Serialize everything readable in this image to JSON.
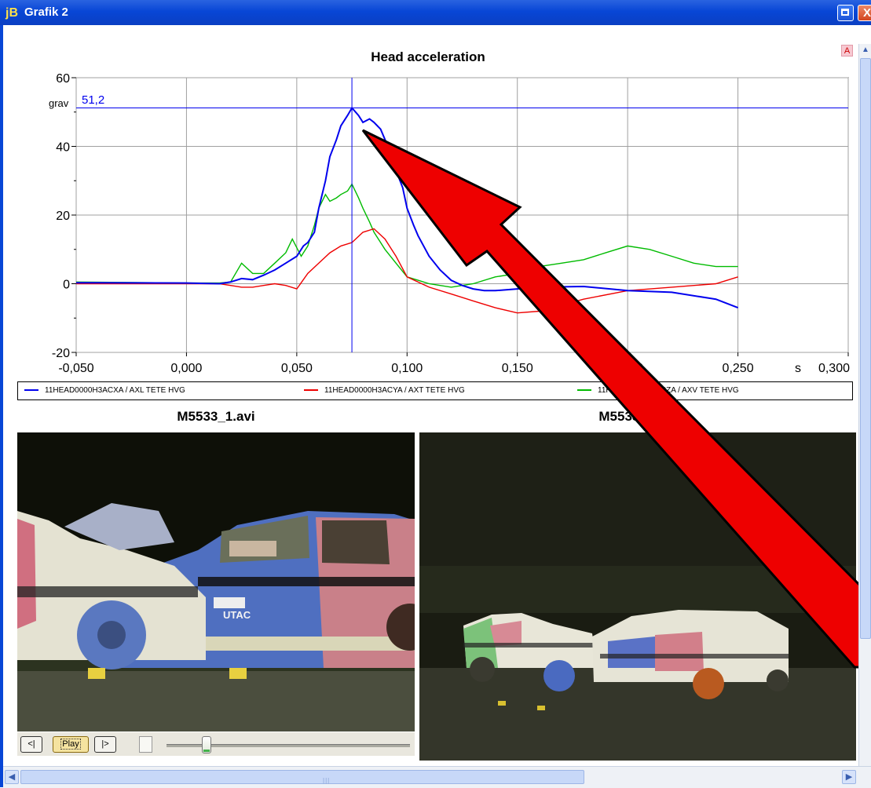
{
  "window": {
    "app_icon": "jB",
    "title": "Grafik 2",
    "close_glyph": "X",
    "corner_badge": "A"
  },
  "chart": {
    "title": "Head acceleration",
    "y_unit": "grav",
    "x_unit": "s",
    "cursor_readout": "51,2",
    "y_ticks": [
      "60",
      "40",
      "20",
      "0",
      "-20"
    ],
    "x_ticks": [
      "-0,050",
      "0,000",
      "0,050",
      "0,100",
      "0,150",
      "0,200",
      "0,250",
      "0,300"
    ]
  },
  "chart_data": {
    "type": "line",
    "title": "Head acceleration",
    "xlabel": "s",
    "ylabel": "grav",
    "xlim": [
      -0.05,
      0.3
    ],
    "ylim": [
      -20,
      60
    ],
    "grid": true,
    "legend_position": "bottom",
    "cursor": {
      "x": 0.075,
      "y": 51.2,
      "label": "51,2"
    },
    "series": [
      {
        "name": "11HEAD0000H3ACXA / AXL TETE HVG",
        "color": "#0000ee",
        "x": [
          -0.05,
          0.0,
          0.015,
          0.02,
          0.025,
          0.03,
          0.035,
          0.04,
          0.045,
          0.05,
          0.053,
          0.055,
          0.058,
          0.06,
          0.063,
          0.065,
          0.068,
          0.07,
          0.073,
          0.075,
          0.078,
          0.08,
          0.083,
          0.085,
          0.088,
          0.09,
          0.093,
          0.095,
          0.098,
          0.1,
          0.103,
          0.105,
          0.11,
          0.115,
          0.12,
          0.125,
          0.13,
          0.135,
          0.14,
          0.15,
          0.16,
          0.18,
          0.2,
          0.22,
          0.24,
          0.25
        ],
        "y": [
          0.3,
          0.2,
          0,
          0.5,
          1.5,
          1.2,
          2.5,
          4,
          6,
          8,
          11,
          12,
          15,
          22,
          30,
          37,
          42,
          46,
          49,
          51.2,
          49,
          47,
          48,
          47,
          45,
          42,
          38,
          33,
          28,
          22,
          17,
          14,
          8,
          4,
          1,
          -0.5,
          -1.5,
          -2,
          -2,
          -1.5,
          -1,
          -0.8,
          -2,
          -2.5,
          -4.5,
          -7
        ]
      },
      {
        "name": "11HEAD0000H3ACYA / AXT TETE HVG",
        "color": "#ee0000",
        "x": [
          -0.05,
          0.0,
          0.015,
          0.02,
          0.025,
          0.03,
          0.035,
          0.04,
          0.045,
          0.05,
          0.055,
          0.06,
          0.065,
          0.07,
          0.075,
          0.08,
          0.085,
          0.09,
          0.095,
          0.1,
          0.11,
          0.12,
          0.13,
          0.14,
          0.15,
          0.16,
          0.18,
          0.2,
          0.22,
          0.24,
          0.25
        ],
        "y": [
          0,
          0,
          0,
          -0.5,
          -1,
          -1,
          -0.5,
          0,
          -0.5,
          -1.5,
          3,
          6,
          9,
          11,
          12,
          15,
          16,
          13,
          8,
          2,
          -1,
          -3,
          -5,
          -7,
          -8.5,
          -8,
          -4.5,
          -2,
          -1,
          0,
          2
        ]
      },
      {
        "name": "11HEAD0000H3ACZA / AXV TETE HVG",
        "color": "#00bb00",
        "x": [
          -0.05,
          0.0,
          0.015,
          0.02,
          0.025,
          0.03,
          0.035,
          0.04,
          0.045,
          0.048,
          0.052,
          0.055,
          0.058,
          0.06,
          0.063,
          0.065,
          0.068,
          0.07,
          0.073,
          0.075,
          0.078,
          0.08,
          0.083,
          0.085,
          0.088,
          0.09,
          0.095,
          0.1,
          0.105,
          0.11,
          0.12,
          0.13,
          0.14,
          0.15,
          0.16,
          0.17,
          0.18,
          0.19,
          0.2,
          0.21,
          0.22,
          0.23,
          0.24,
          0.25
        ],
        "y": [
          0.5,
          0.2,
          0.2,
          0.5,
          6,
          3,
          3,
          6,
          9,
          13,
          8,
          11,
          17,
          22,
          26,
          24,
          25,
          26,
          27,
          29,
          25,
          22,
          18,
          15,
          12,
          10,
          6,
          2,
          1,
          0,
          -1,
          0,
          2,
          3,
          5,
          6,
          7,
          9,
          11,
          10,
          8,
          6,
          5,
          5
        ]
      }
    ]
  },
  "legend": [
    {
      "label": "11HEAD0000H3ACXA / AXL TETE HVG",
      "color": "#0000ee"
    },
    {
      "label": "11HEAD0000H3ACYA / AXT TETE HVG",
      "color": "#ee0000"
    },
    {
      "label": "11HEAD0000H3ACZA / AXV TETE HVG",
      "color": "#00bb00"
    }
  ],
  "videos": {
    "left_title": "M5533_1.avi",
    "right_title": "M5533_2.avi",
    "car_marking": "UTAC"
  },
  "player": {
    "prev_label": "<|",
    "play_label": "Play",
    "next_label": "|>",
    "position": 0.15
  },
  "annotation": {
    "type": "arrow",
    "color": "#ee0000"
  },
  "icons": {
    "maximize": "maximize-icon",
    "close": "close-icon",
    "scroll_up": "scroll-up-icon",
    "scroll_left": "scroll-left-icon",
    "scroll_right": "scroll-right-icon"
  }
}
